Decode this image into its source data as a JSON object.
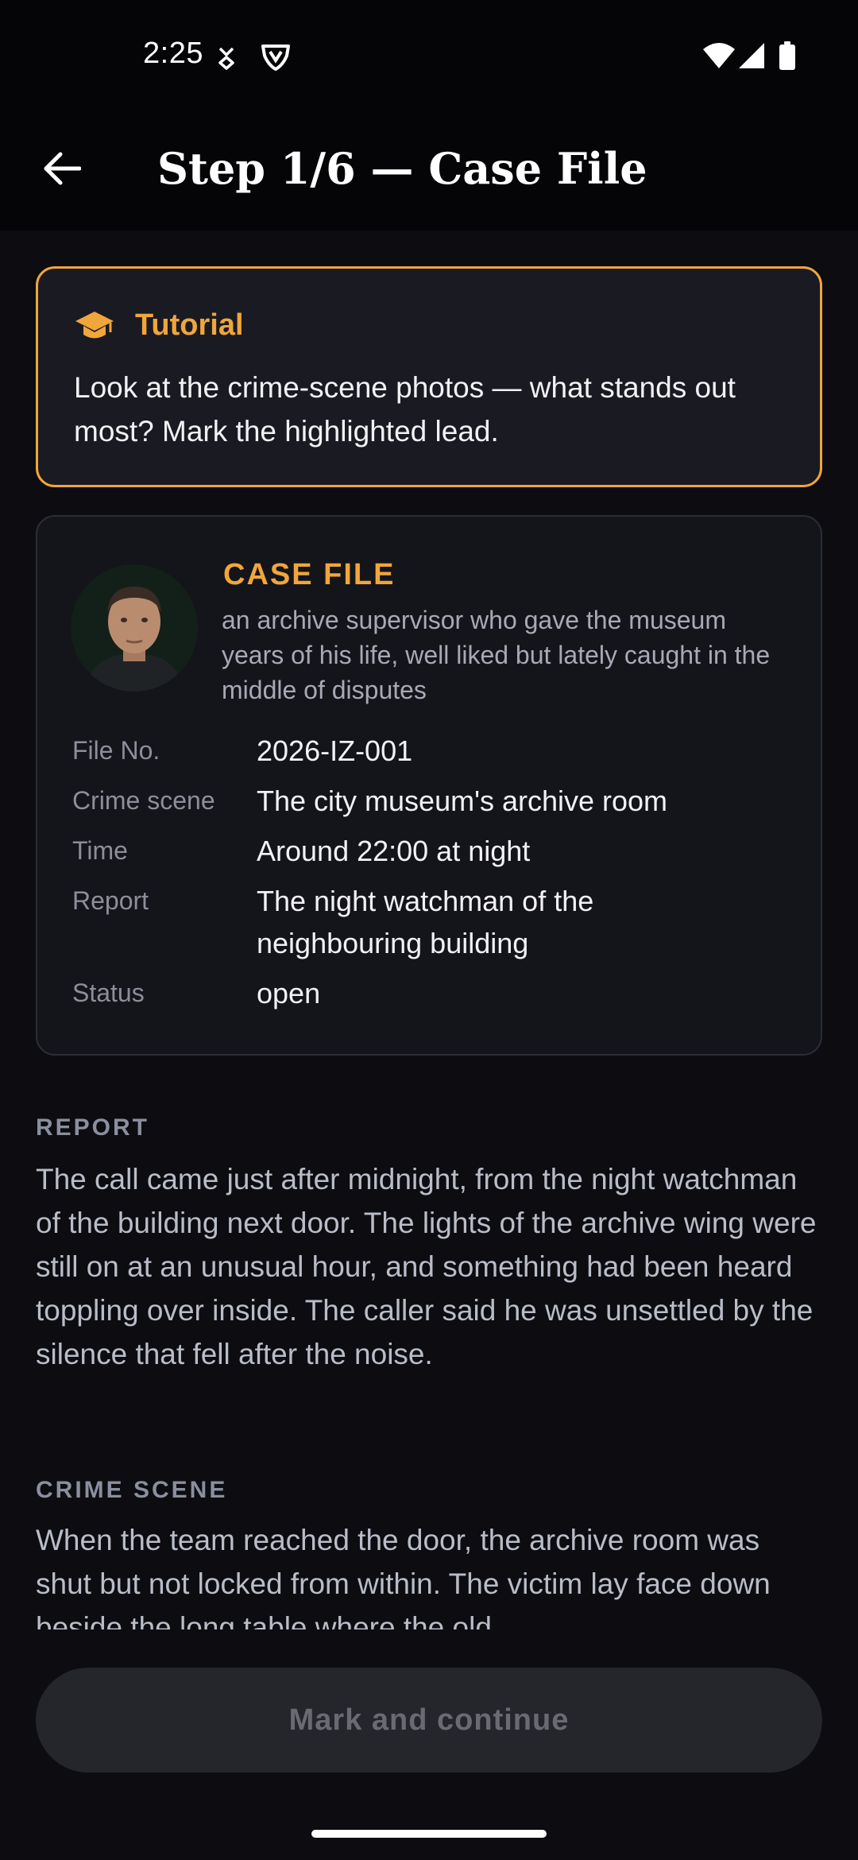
{
  "status_bar": {
    "time": "2:25",
    "icons": [
      "download-notification-icon",
      "shield-vpn-icon",
      "wifi-icon",
      "cellular-signal-icon",
      "battery-icon"
    ]
  },
  "app_bar": {
    "back_icon": "arrow-left-icon",
    "title": "Step 1/6 — Case File"
  },
  "tutorial": {
    "icon": "graduation-cap-icon",
    "title": "Tutorial",
    "text": "Look at the crime-scene photos — what stands out most? Mark the highlighted lead."
  },
  "case_file": {
    "label": "CASE FILE",
    "description": "an archive supervisor who gave the museum years of his life, well liked but lately caught in the middle of disputes",
    "fields": [
      {
        "label": "File No.",
        "value": "2026-IZ-001"
      },
      {
        "label": "Crime scene",
        "value": "The city museum's archive room"
      },
      {
        "label": "Time",
        "value": "Around 22:00 at night"
      },
      {
        "label": "Report",
        "value": "The night watchman of the neighbouring building"
      },
      {
        "label": "Status",
        "value": "open"
      }
    ]
  },
  "report": {
    "heading": "REPORT",
    "body": "The call came just after midnight, from the night watchman of the building next door. The lights of the archive wing were still on at an unusual hour, and something had been heard toppling over inside. The caller said he was unsettled by the silence that fell after the noise."
  },
  "crime_scene": {
    "heading": "CRIME SCENE",
    "body": "When the team reached the door, the archive room was shut but not locked from within. The victim lay face down beside the long table where the old"
  },
  "action": {
    "button_label": "Mark and continue"
  },
  "colors": {
    "accent": "#f0a63a",
    "background": "#0c0c11",
    "card": "#14141b",
    "button_disabled": "#25252c"
  }
}
